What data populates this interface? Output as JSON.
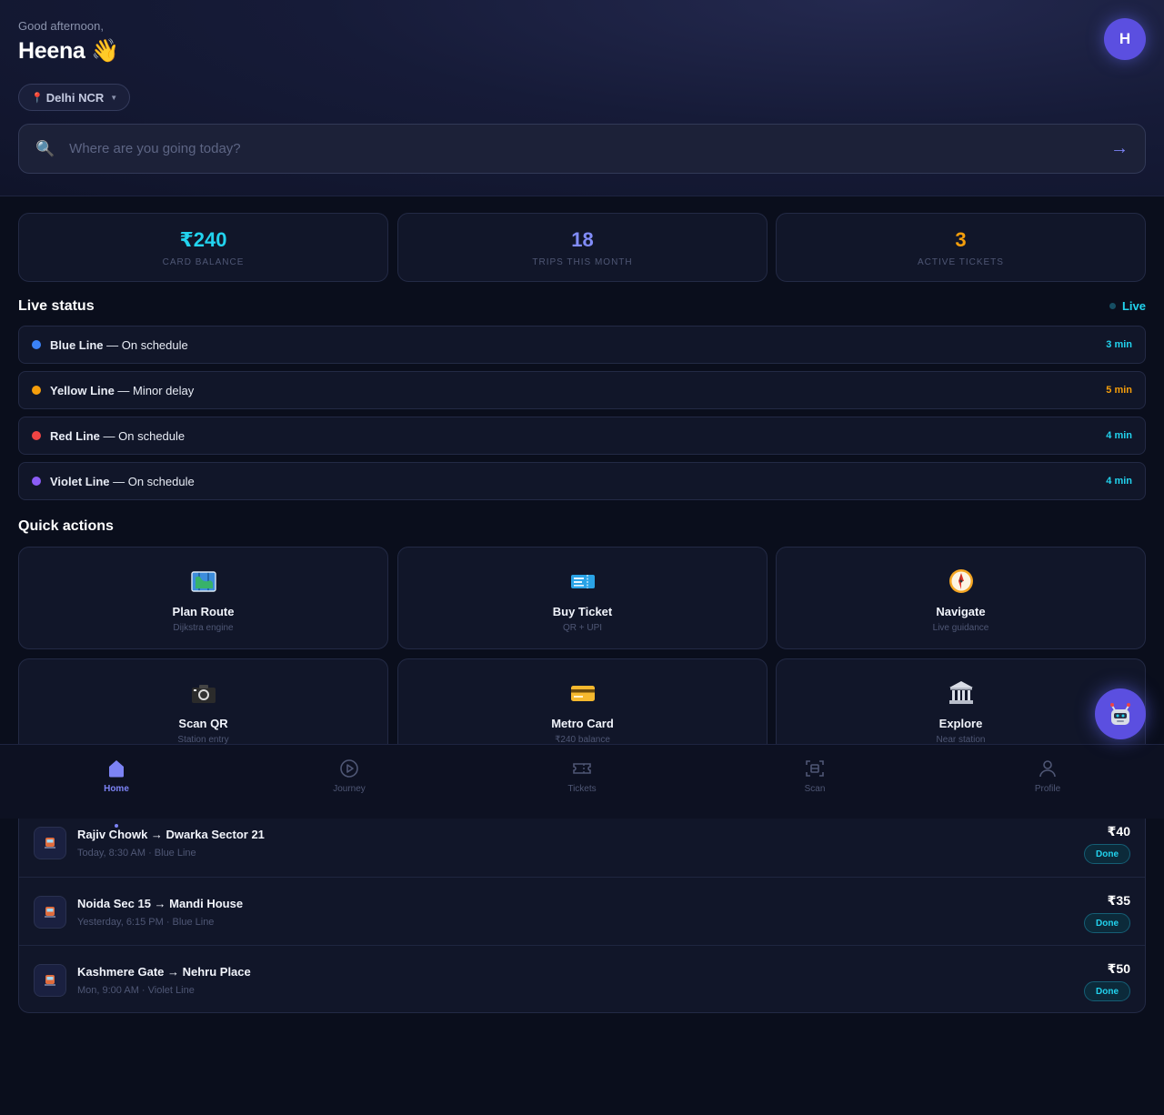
{
  "header": {
    "greeting": "Good afternoon,",
    "user_name": "Heena",
    "wave_emoji": "👋",
    "avatar_initial": "H",
    "city": {
      "pin": "📍",
      "label": "Delhi NCR",
      "caret": "▼"
    },
    "search": {
      "placeholder": "Where are you going today?",
      "value": "",
      "icon": "🔍",
      "go_arrow": "→"
    }
  },
  "stats": [
    {
      "value": "₹240",
      "label": "CARD BALANCE",
      "color": "#22d3ee"
    },
    {
      "value": "18",
      "label": "TRIPS THIS MONTH",
      "color": "#818cf8"
    },
    {
      "value": "3",
      "label": "ACTIVE TICKETS",
      "color": "#f59e0b"
    }
  ],
  "live_status": {
    "title": "Live status",
    "indicator": "Live",
    "lines": [
      {
        "name": "Blue Line",
        "status": " — On schedule",
        "eta": "3 min",
        "color": "#3b82f6",
        "eta_color": "#22d3ee"
      },
      {
        "name": "Yellow Line",
        "status": " — Minor delay",
        "eta": "5 min",
        "color": "#f59e0b",
        "eta_color": "#f59e0b"
      },
      {
        "name": "Red Line",
        "status": " — On schedule",
        "eta": "4 min",
        "color": "#ef4444",
        "eta_color": "#22d3ee"
      },
      {
        "name": "Violet Line",
        "status": " — On schedule",
        "eta": "4 min",
        "color": "#8b5cf6",
        "eta_color": "#22d3ee"
      }
    ]
  },
  "quick_actions": {
    "title": "Quick actions",
    "items": [
      {
        "title": "Plan Route",
        "subtitle": "Dijkstra engine",
        "icon": "map-icon"
      },
      {
        "title": "Buy Ticket",
        "subtitle": "QR + UPI",
        "icon": "ticket-icon"
      },
      {
        "title": "Navigate",
        "subtitle": "Live guidance",
        "icon": "compass-icon"
      },
      {
        "title": "Scan QR",
        "subtitle": "Station entry",
        "icon": "camera-icon"
      },
      {
        "title": "Metro Card",
        "subtitle": "₹240 balance",
        "icon": "credit-card-icon"
      },
      {
        "title": "Explore",
        "subtitle": "Near station",
        "icon": "landmark-icon"
      }
    ]
  },
  "assistant_fab": {
    "icon": "robot-icon"
  },
  "bottom_nav": {
    "items": [
      {
        "label": "Home",
        "icon": "home-icon",
        "active": true
      },
      {
        "label": "Journey",
        "icon": "play-circle-icon",
        "active": false
      },
      {
        "label": "Tickets",
        "icon": "ticket-outline-icon",
        "active": false
      },
      {
        "label": "Scan",
        "icon": "scan-icon",
        "active": false
      },
      {
        "label": "Profile",
        "icon": "user-icon",
        "active": false
      }
    ]
  },
  "recent_trips": [
    {
      "route": "Rajiv Chowk → Dwarka Sector 21",
      "meta": "Today, 8:30 AM · Blue Line",
      "fare": "₹40",
      "status": "Done"
    },
    {
      "route": "Noida Sec 15 → Mandi House",
      "meta": "Yesterday, 6:15 PM · Blue Line",
      "fare": "₹35",
      "status": "Done"
    },
    {
      "route": "Kashmere Gate → Nehru Place",
      "meta": "Mon, 9:00 AM · Violet Line",
      "fare": "₹50",
      "status": "Done"
    }
  ]
}
